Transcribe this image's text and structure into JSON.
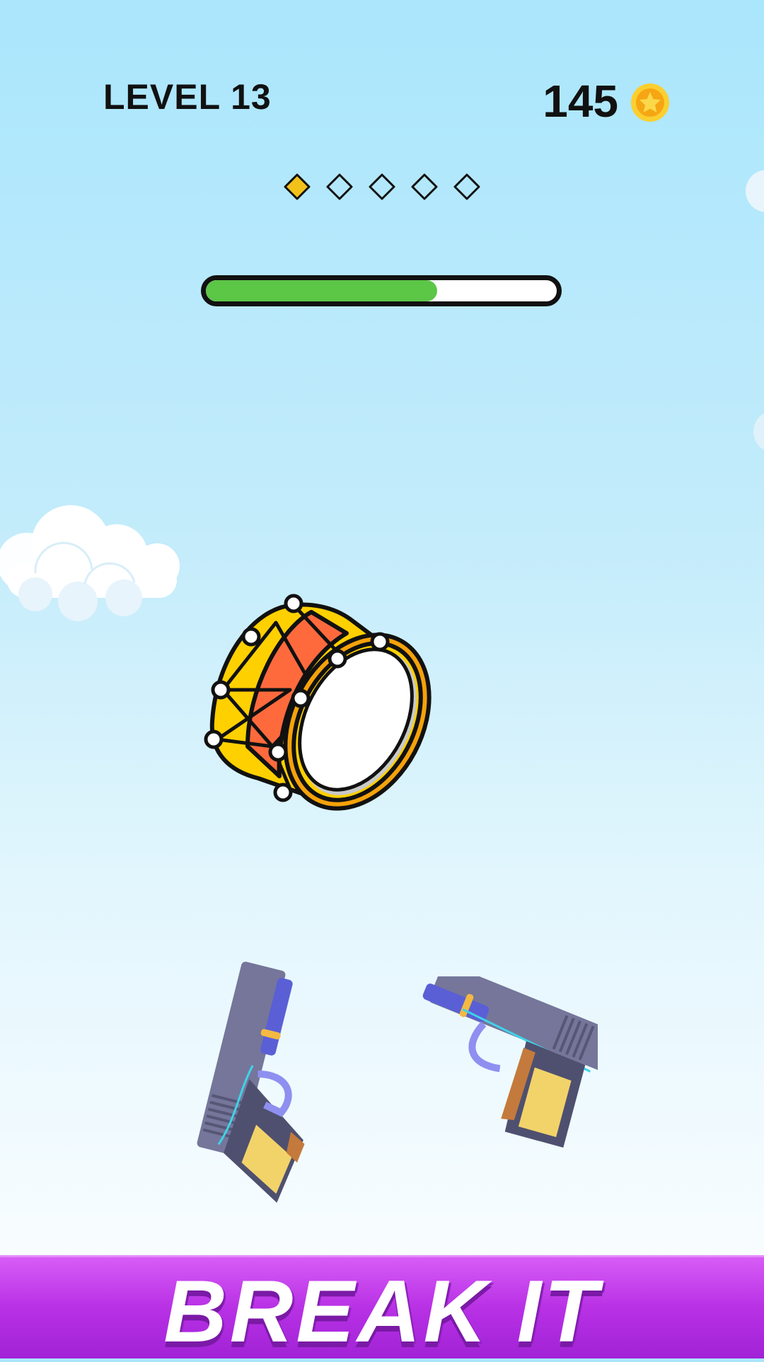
{
  "hud": {
    "level_label": "LEVEL 13",
    "coins": "145",
    "coin_icon": "star-coin-icon",
    "stages_total": 5,
    "stages_completed": 1,
    "progress_fraction": 0.66
  },
  "scene": {
    "target_object": "drum",
    "weapons": [
      "pistol",
      "pistol"
    ]
  },
  "banner": {
    "text": "BREAK IT"
  },
  "colors": {
    "progress_fill": "#5cc646",
    "banner": "#b831e5",
    "active_stage": "#f2c21a",
    "coin": "#f7b716"
  }
}
